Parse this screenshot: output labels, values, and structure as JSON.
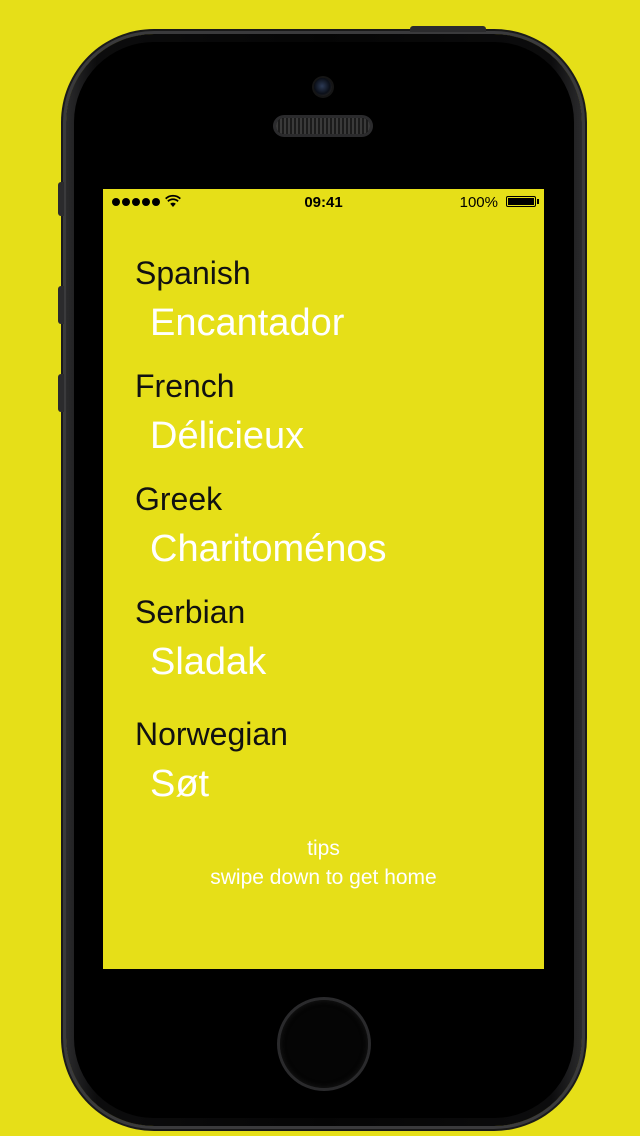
{
  "status_bar": {
    "time": "09:41",
    "battery_percent": "100%",
    "battery_level": 1.0,
    "signal_bars": 5,
    "wifi_icon": "wifi-icon"
  },
  "languages": [
    {
      "name": "Spanish",
      "word": "Encantador"
    },
    {
      "name": "French",
      "word": "Délicieux"
    },
    {
      "name": "Greek",
      "word": "Charitoménos"
    },
    {
      "name": "Serbian",
      "word": "Sladak"
    },
    {
      "name": "Norwegian",
      "word": "Søt"
    }
  ],
  "tips": {
    "title": "tips",
    "text": "swipe down to get home"
  },
  "colors": {
    "background": "#e6df18",
    "word": "#ffffff",
    "label": "#111111"
  }
}
